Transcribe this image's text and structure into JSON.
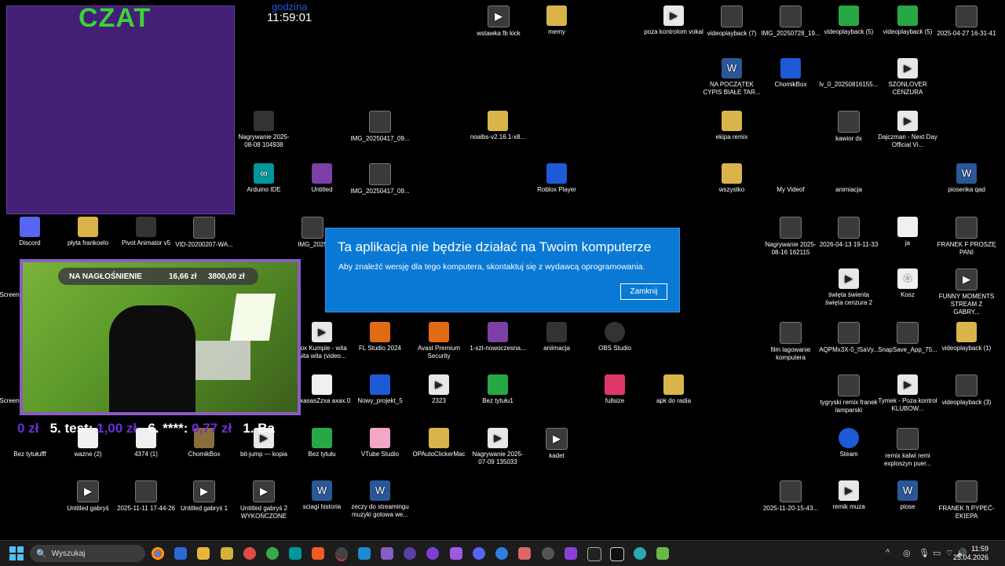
{
  "overlay": {
    "chat_title": "CZAT",
    "clock_label": "godzina",
    "clock_time": "11:59:01",
    "cam_bar_title": "NA NAGŁOŚNIENIE",
    "cam_bar_value1": "16,66 zł",
    "cam_bar_value2": "3800,00 zł",
    "ticker": [
      {
        "label": "",
        "amount": "0 zł"
      },
      {
        "label": "5. test:",
        "amount": "1,00 zł"
      },
      {
        "label": "6. ****:",
        "amount": "0,77 zł"
      },
      {
        "label": "1. Ba",
        "amount": ""
      }
    ]
  },
  "dialog": {
    "title": "Ta aplikacja nie będzie działać na Twoim komputerze",
    "message": "Aby znaleźć wersję dla tego komputera, skontaktuj się z wydawcą oprogramowania.",
    "close_label": "Zamknij"
  },
  "desktop_icons": [
    {
      "label": "wstawka fb kick",
      "icon": "media-icon"
    },
    {
      "label": "memy",
      "icon": "folder-icon"
    },
    {
      "label": "poza kontrolom vokal",
      "icon": "media-icon"
    },
    {
      "label": "videoplayback (7)",
      "icon": "video-icon"
    },
    {
      "label": "IMG_20250728_19...",
      "icon": "video-icon"
    },
    {
      "label": "videoplayback (5)",
      "icon": "video-icon"
    },
    {
      "label": "videoplayback (5)",
      "icon": "video-icon"
    },
    {
      "label": "2025-04-27 16-31-41",
      "icon": "video-icon"
    },
    {
      "label": "NA POCZĄTEK CYPIS BIAŁE TAR...",
      "icon": "word-icon"
    },
    {
      "label": "ChomikBox",
      "icon": "app-icon"
    },
    {
      "label": "lv_0_20250816155...",
      "icon": "video-icon"
    },
    {
      "label": "SZONLOVER CENZURA",
      "icon": "media-icon"
    },
    {
      "label": "Nagrywanie 2025-08-08 104938",
      "icon": "media-icon"
    },
    {
      "label": "IMG_20250417_09...",
      "icon": "video-icon"
    },
    {
      "label": "noalbs-v2.16.1-x8...",
      "icon": "folder-icon"
    },
    {
      "label": "ekipa remix",
      "icon": "folder-icon"
    },
    {
      "label": "kawior dx",
      "icon": "video-icon"
    },
    {
      "label": "Dajczman - Next Day Official Vi...",
      "icon": "media-icon"
    },
    {
      "label": "Arduino IDE",
      "icon": "app-icon"
    },
    {
      "label": "Untitled",
      "icon": "app-icon"
    },
    {
      "label": "IMG_20250417_09...",
      "icon": "video-icon"
    },
    {
      "label": "Roblox Player",
      "icon": "app-icon"
    },
    {
      "label": "wszystko",
      "icon": "folder-icon"
    },
    {
      "label": "My Videof",
      "icon": "video-icon"
    },
    {
      "label": "animiacja",
      "icon": "video-icon"
    },
    {
      "label": "piosenka qad",
      "icon": "word-icon"
    },
    {
      "label": "Discord",
      "icon": "discord-icon"
    },
    {
      "label": "płyta frankoelo",
      "icon": "folder-icon"
    },
    {
      "label": "Pivot Animator v5",
      "icon": "app-icon"
    },
    {
      "label": "VID-20200207-WA...",
      "icon": "video-icon"
    },
    {
      "label": "IMG_2025",
      "icon": "video-icon"
    },
    {
      "label": "Nagrywanie 2025-08-16 162115",
      "icon": "video-icon"
    },
    {
      "label": "2026-04-13 19-11-33",
      "icon": "video-icon"
    },
    {
      "label": "ja",
      "icon": "image-icon"
    },
    {
      "label": "FRANEK F PROSZĘ PANI",
      "icon": "video-icon"
    },
    {
      "label": "Screen",
      "icon": "image-icon"
    },
    {
      "label": "święta świenta święta cenzura 2",
      "icon": "media-icon"
    },
    {
      "label": "Kosz",
      "icon": "recycle-bin-icon"
    },
    {
      "label": "FUNNY MOMENTS STREAM Z GABRY...",
      "icon": "media-icon"
    },
    {
      "label": "box Kumple - wita wita wita (video...",
      "icon": "media-icon"
    },
    {
      "label": "FL Studio 2024",
      "icon": "app-icon"
    },
    {
      "label": "Avast Premium Security",
      "icon": "app-icon"
    },
    {
      "label": "1-szt-nowoczesna...",
      "icon": "app-icon"
    },
    {
      "label": "aniimacja",
      "icon": "app-icon"
    },
    {
      "label": "OBS Studio",
      "icon": "app-icon"
    },
    {
      "label": "film lagowanie komputera",
      "icon": "video-icon"
    },
    {
      "label": "AQPMx3X-0_lSaVy...",
      "icon": "video-icon"
    },
    {
      "label": "SnapSave_App_75...",
      "icon": "video-icon"
    },
    {
      "label": "videoplayback (1)",
      "icon": "video-icon"
    },
    {
      "label": "Screen",
      "icon": "image-icon"
    },
    {
      "label": "asxasasZzxa axax.0",
      "icon": "document-icon"
    },
    {
      "label": "Nowy_projekt_5",
      "icon": "app-icon"
    },
    {
      "label": "2323",
      "icon": "media-icon"
    },
    {
      "label": "Bez tytułu1",
      "icon": "app-icon"
    },
    {
      "label": "fullsize",
      "icon": "image-icon"
    },
    {
      "label": "apk do radia",
      "icon": "folder-icon"
    },
    {
      "label": "tygryski remix franek lamparski",
      "icon": "video-icon"
    },
    {
      "label": "Tymek - Poza kontrol KLUBOW...",
      "icon": "media-icon"
    },
    {
      "label": "videoplayback (3)",
      "icon": "video-icon"
    },
    {
      "label": "Bez tytułufff",
      "icon": "image-icon"
    },
    {
      "label": "wazne (2)",
      "icon": "image-icon"
    },
    {
      "label": "4374 (1)",
      "icon": "image-icon"
    },
    {
      "label": "ChomikBox",
      "icon": "app-icon"
    },
    {
      "label": "bit-jump — kopia",
      "icon": "media-icon"
    },
    {
      "label": "Bez tytułu",
      "icon": "app-icon"
    },
    {
      "label": "VTube Studio",
      "icon": "app-icon"
    },
    {
      "label": "OPAutoClickerMac",
      "icon": "folder-icon"
    },
    {
      "label": "Nagrywanie 2025-07-09 135033",
      "icon": "media-icon"
    },
    {
      "label": "kadet",
      "icon": "media-icon"
    },
    {
      "label": "Steam",
      "icon": "app-icon"
    },
    {
      "label": "remix kalwi remi exploszyn puer...",
      "icon": "video-icon"
    },
    {
      "label": "Untitled gabryś",
      "icon": "media-icon"
    },
    {
      "label": "2025-11-11 17-44-26",
      "icon": "video-icon"
    },
    {
      "label": "Untitled gabryś 1",
      "icon": "media-icon"
    },
    {
      "label": "Untitled gabryś 2 WYKOŃCZONE",
      "icon": "media-icon"
    },
    {
      "label": "sciagi historia",
      "icon": "word-icon"
    },
    {
      "label": "zeczy do streamingu muzyki gotowa we...",
      "icon": "word-icon"
    },
    {
      "label": "2025-11-20-15-43...",
      "icon": "video-icon"
    },
    {
      "label": "remik muza",
      "icon": "media-icon"
    },
    {
      "label": "piose",
      "icon": "word-icon"
    },
    {
      "label": "FRANEK ft PYPEĆ-EKIEPA",
      "icon": "video-icon"
    }
  ],
  "taskbar": {
    "search_placeholder": "Wyszukaj",
    "time": "11:59",
    "date": "25.04.2026",
    "pinned": [
      "chrome-icon",
      "store-icon",
      "explorer-icon",
      "sticky-icon",
      "maps-icon",
      "chrome-profile-icon",
      "arduino-icon",
      "brave-icon",
      "obs-icon",
      "vscode-icon",
      "vs-icon",
      "sb-icon",
      "app-icon",
      "triangle-icon",
      "discord-icon",
      "snapchat-icon",
      "paint-icon",
      "obs2-icon",
      "terminal-icon",
      "capcut-icon",
      "p-icon",
      "edge-icon",
      "cube-icon"
    ]
  },
  "colors": {
    "dialog_bg": "#0a79d5",
    "chat_bg": "#562896",
    "chat_title": "#3ad23a",
    "ticker_amount": "#6a2fd8",
    "cam_border": "#8c5cc6"
  }
}
